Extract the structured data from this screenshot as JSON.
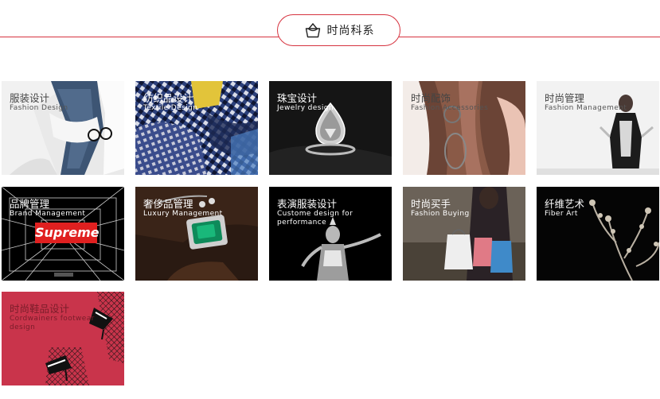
{
  "header": {
    "title": "时尚科系",
    "icon": "handbag-icon",
    "accent_color": "#d6333f"
  },
  "departments": [
    {
      "zh": "服装设计",
      "en": "Fashion Design"
    },
    {
      "zh": "纺织品设计",
      "en": "Textile Design"
    },
    {
      "zh": "珠宝设计",
      "en": "Jewelry design"
    },
    {
      "zh": "时尚配饰",
      "en": "Fashion Accessories"
    },
    {
      "zh": "时尚管理",
      "en": "Fashion Management"
    },
    {
      "zh": "品牌管理",
      "en": "Brand Management",
      "logo_text": "Supreme"
    },
    {
      "zh": "奢侈品管理",
      "en": "Luxury Management"
    },
    {
      "zh": "表演服装设计",
      "en": "Custome design for performance"
    },
    {
      "zh": "时尚买手",
      "en": "Fashion Buying"
    },
    {
      "zh": "纤维艺术",
      "en": "Fiber Art"
    },
    {
      "zh": "时尚鞋品设计",
      "en": "Cordwainers footwear design"
    }
  ]
}
